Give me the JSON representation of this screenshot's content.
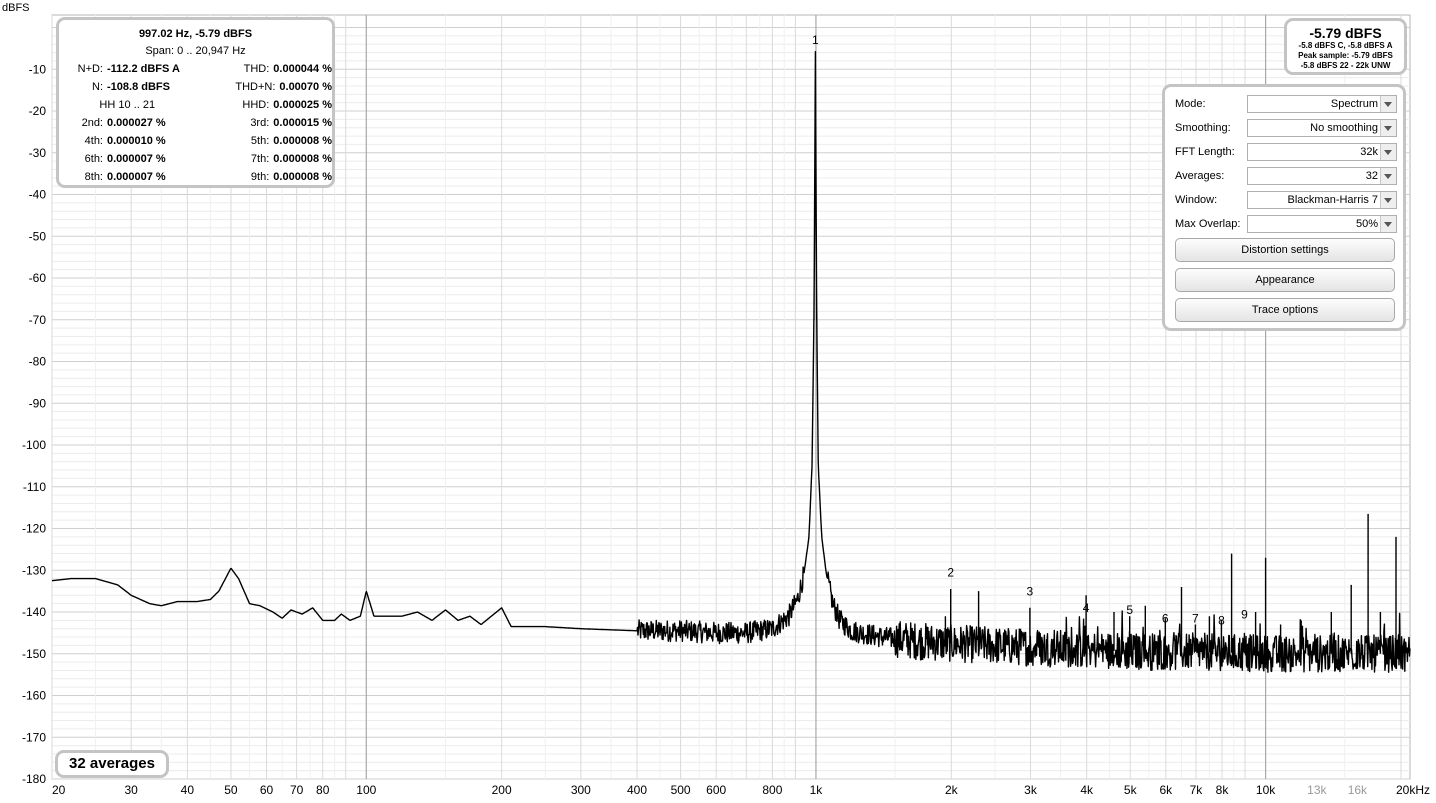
{
  "chart_data": {
    "type": "line",
    "ylabel": "dBFS",
    "y_ticks": [
      -10,
      -20,
      -30,
      -40,
      -50,
      -60,
      -70,
      -80,
      -90,
      -100,
      -110,
      -120,
      -130,
      -140,
      -150,
      -160,
      -170,
      -180
    ],
    "ylim": [
      -180,
      3
    ],
    "x_scale": "log",
    "xlim": [
      20,
      20947
    ],
    "x_tick_labels": [
      {
        "f": 20,
        "label": "20"
      },
      {
        "f": 30,
        "label": "30"
      },
      {
        "f": 40,
        "label": "40"
      },
      {
        "f": 50,
        "label": "50"
      },
      {
        "f": 60,
        "label": "60"
      },
      {
        "f": 70,
        "label": "70"
      },
      {
        "f": 80,
        "label": "80"
      },
      {
        "f": 100,
        "label": "100"
      },
      {
        "f": 200,
        "label": "200"
      },
      {
        "f": 300,
        "label": "300"
      },
      {
        "f": 400,
        "label": "400"
      },
      {
        "f": 500,
        "label": "500"
      },
      {
        "f": 600,
        "label": "600"
      },
      {
        "f": 800,
        "label": "800"
      },
      {
        "f": 1000,
        "label": "1k"
      },
      {
        "f": 2000,
        "label": "2k"
      },
      {
        "f": 3000,
        "label": "3k"
      },
      {
        "f": 4000,
        "label": "4k"
      },
      {
        "f": 5000,
        "label": "5k"
      },
      {
        "f": 6000,
        "label": "6k"
      },
      {
        "f": 7000,
        "label": "7k"
      },
      {
        "f": 8000,
        "label": "8k"
      },
      {
        "f": 10000,
        "label": "10k"
      },
      {
        "f": 13000,
        "label": "13k"
      },
      {
        "f": 16000,
        "label": "16k"
      },
      {
        "f": 20000,
        "label": "20kHz"
      }
    ],
    "grid": true,
    "series": [
      {
        "color": "#000000",
        "points": [
          [
            20,
            -132.5
          ],
          [
            22,
            -132
          ],
          [
            25,
            -132
          ],
          [
            28,
            -133.5
          ],
          [
            30,
            -136
          ],
          [
            33,
            -138
          ],
          [
            35,
            -138.5
          ],
          [
            38,
            -137.5
          ],
          [
            42,
            -137.5
          ],
          [
            45,
            -137
          ],
          [
            47,
            -135
          ],
          [
            50,
            -129.5
          ],
          [
            52,
            -132
          ],
          [
            55,
            -138
          ],
          [
            58,
            -138.5
          ],
          [
            62,
            -140
          ],
          [
            65,
            -141.5
          ],
          [
            68,
            -139.5
          ],
          [
            72,
            -140.5
          ],
          [
            76,
            -139
          ],
          [
            80,
            -142
          ],
          [
            85,
            -142
          ],
          [
            88,
            -140.5
          ],
          [
            92,
            -142
          ],
          [
            97,
            -141
          ],
          [
            100,
            -135
          ],
          [
            104,
            -141
          ],
          [
            110,
            -141
          ],
          [
            120,
            -141
          ],
          [
            130,
            -140
          ],
          [
            140,
            -142
          ],
          [
            150,
            -139.5
          ],
          [
            160,
            -142
          ],
          [
            170,
            -141
          ],
          [
            180,
            -143
          ],
          [
            200,
            -139
          ],
          [
            210,
            -143.5
          ],
          [
            250,
            -143.5
          ],
          [
            300,
            -144
          ],
          [
            400,
            -144.5
          ],
          [
            500,
            -144.5
          ],
          [
            600,
            -145
          ],
          [
            700,
            -145
          ],
          [
            800,
            -144
          ],
          [
            870,
            -141
          ],
          [
            910,
            -137
          ],
          [
            940,
            -131
          ],
          [
            965,
            -122
          ],
          [
            980,
            -105
          ],
          [
            990,
            -70
          ],
          [
            994,
            -40
          ],
          [
            997,
            -5.8
          ],
          [
            1000,
            -40
          ],
          [
            1004,
            -70
          ],
          [
            1012,
            -105
          ],
          [
            1030,
            -122
          ],
          [
            1055,
            -131
          ],
          [
            1090,
            -138
          ],
          [
            1130,
            -142
          ],
          [
            1200,
            -144.5
          ],
          [
            1400,
            -146
          ],
          [
            1700,
            -147
          ],
          [
            2000,
            -147.5
          ],
          [
            2500,
            -148
          ],
          [
            3000,
            -148.5
          ],
          [
            4000,
            -149
          ],
          [
            5000,
            -149.5
          ],
          [
            7000,
            -149.5
          ],
          [
            10000,
            -150
          ],
          [
            14000,
            -150
          ],
          [
            20947,
            -150
          ]
        ],
        "noise_from_hz": 400,
        "spikes": [
          [
            1940,
            -141
          ],
          [
            1994,
            -134.5
          ],
          [
            2300,
            -135
          ],
          [
            2850,
            -144
          ],
          [
            2991,
            -139
          ],
          [
            3988,
            -136
          ],
          [
            4600,
            -140
          ],
          [
            4985,
            -141
          ],
          [
            5400,
            -138.5
          ],
          [
            5982,
            -141.5
          ],
          [
            6500,
            -134
          ],
          [
            6979,
            -143
          ],
          [
            7500,
            -141
          ],
          [
            7976,
            -142
          ],
          [
            8400,
            -126
          ],
          [
            8973,
            -145
          ],
          [
            9500,
            -140
          ],
          [
            10000,
            -127
          ],
          [
            10800,
            -143
          ],
          [
            12000,
            -142
          ],
          [
            14000,
            -140
          ],
          [
            15500,
            -133.5
          ],
          [
            16900,
            -116.5
          ],
          [
            18000,
            -140
          ],
          [
            19500,
            -122
          ]
        ]
      }
    ],
    "annotations": [
      {
        "f": 997,
        "db": -4,
        "label": "1"
      },
      {
        "f": 1994,
        "db": -131.5,
        "label": "2"
      },
      {
        "f": 2991,
        "db": -136,
        "label": "3"
      },
      {
        "f": 3988,
        "db": -140,
        "label": "4"
      },
      {
        "f": 4985,
        "db": -140.5,
        "label": "5"
      },
      {
        "f": 5982,
        "db": -142.5,
        "label": "6"
      },
      {
        "f": 6979,
        "db": -142.5,
        "label": "7"
      },
      {
        "f": 7976,
        "db": -143,
        "label": "8"
      },
      {
        "f": 8973,
        "db": -141.5,
        "label": "9"
      }
    ]
  },
  "stats": {
    "title": "997.02 Hz, -5.79 dBFS",
    "span": "Span: 0 .. 20,947 Hz",
    "rows": [
      {
        "l1": "N+D:",
        "v1": "-112.2 dBFS A",
        "l2": "THD:",
        "v2": "0.000044 %"
      },
      {
        "l1": "N:",
        "v1": "-108.8 dBFS",
        "l2": "THD+N:",
        "v2": "0.00070 %"
      },
      {
        "l1": "",
        "v1": "HH 10 .. 21",
        "l2": "HHD:",
        "v2": "0.000025 %"
      },
      {
        "l1": "2nd:",
        "v1": "0.000027 %",
        "l2": "3rd:",
        "v2": "0.000015 %"
      },
      {
        "l1": "4th:",
        "v1": "0.000010 %",
        "l2": "5th:",
        "v2": "0.000008 %"
      },
      {
        "l1": "6th:",
        "v1": "0.000007 %",
        "l2": "7th:",
        "v2": "0.000008 %"
      },
      {
        "l1": "8th:",
        "v1": "0.000007 %",
        "l2": "9th:",
        "v2": "0.000008 %"
      }
    ]
  },
  "level": {
    "big": "-5.79 dBFS",
    "line1": "-5.8 dBFS C, -5.8 dBFS A",
    "line2": "Peak sample: -5.79 dBFS",
    "line3": "-5.8 dBFS 22 - 22k UNW"
  },
  "controls": [
    {
      "label": "Mode:",
      "value": "Spectrum"
    },
    {
      "label": "Smoothing:",
      "value": "No smoothing"
    },
    {
      "label": "FFT Length:",
      "value": "32k"
    },
    {
      "label": "Averages:",
      "value": "32"
    },
    {
      "label": "Window:",
      "value": "Blackman-Harris 7"
    },
    {
      "label": "Max Overlap:",
      "value": "50%"
    }
  ],
  "buttons": {
    "distortion": "Distortion settings",
    "appearance": "Appearance",
    "trace": "Trace options"
  },
  "averages_badge": "32 averages"
}
